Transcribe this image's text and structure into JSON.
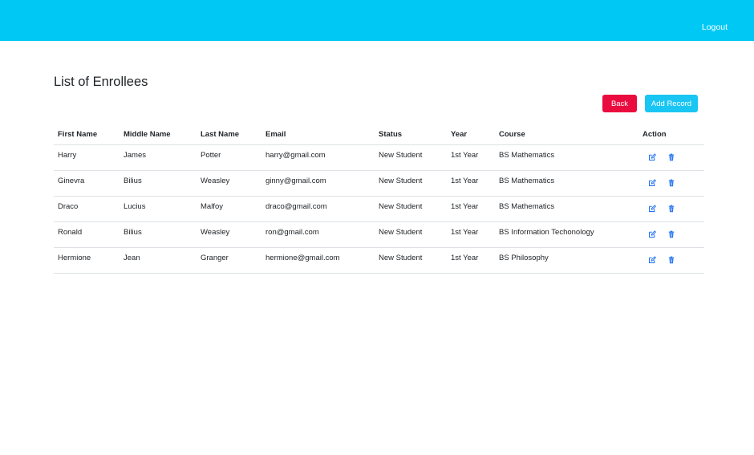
{
  "navbar": {
    "logout_label": "Logout"
  },
  "page": {
    "title": "List of Enrollees"
  },
  "actions": {
    "back_label": "Back",
    "add_label": "Add Record"
  },
  "table": {
    "headers": [
      "First Name",
      "Middle Name",
      "Last Name",
      "Email",
      "Status",
      "Year",
      "Course",
      "Action"
    ],
    "rows": [
      [
        "Harry",
        "James",
        "Potter",
        "harry@gmail.com",
        "New Student",
        "1st Year",
        "BS Mathematics"
      ],
      [
        "Ginevra",
        "Bilius",
        "Weasley",
        "ginny@gmail.com",
        "New Student",
        "1st Year",
        "BS Mathematics"
      ],
      [
        "Draco",
        "Lucius",
        "Malfoy",
        "draco@gmail.com",
        "New Student",
        "1st Year",
        "BS Mathematics"
      ],
      [
        "Ronald",
        "Bilius",
        "Weasley",
        "ron@gmail.com",
        "New Student",
        "1st Year",
        "BS Information Techonology"
      ],
      [
        "Hermione",
        "Jean",
        "Granger",
        "hermione@gmail.com",
        "New Student",
        "1st Year",
        "BS Philosophy"
      ]
    ],
    "row_actions": [
      "edit-icon",
      "trash-icon"
    ]
  },
  "colors": {
    "navbar": "#00c8f4",
    "back": "#ea0b3f",
    "add": "#19c6f3",
    "icon": "#1a6cf2"
  }
}
